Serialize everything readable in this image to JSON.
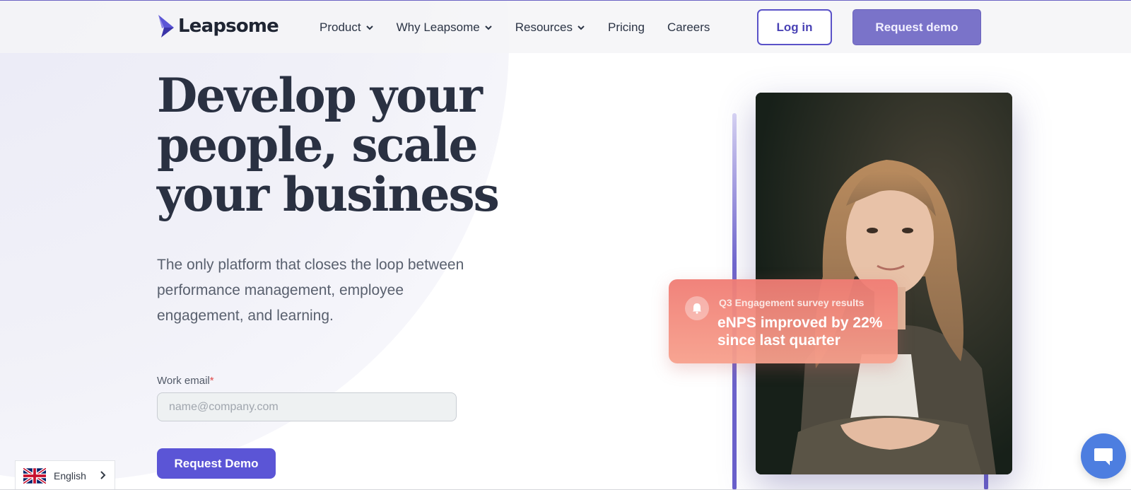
{
  "brand": {
    "name": "Leapsome"
  },
  "nav": {
    "items": [
      {
        "label": "Product",
        "has_dropdown": true
      },
      {
        "label": "Why Leapsome",
        "has_dropdown": true
      },
      {
        "label": "Resources",
        "has_dropdown": true
      },
      {
        "label": "Pricing",
        "has_dropdown": false
      },
      {
        "label": "Careers",
        "has_dropdown": false
      }
    ],
    "login_label": "Log in",
    "request_demo_label": "Request demo"
  },
  "hero": {
    "headline_lines": [
      "Develop your",
      "people, scale",
      "your business"
    ],
    "subtext": "The only platform that closes the loop between performance management, employee engagement, and learning.",
    "email_label": "Work email",
    "email_required_mark": "*",
    "email_placeholder": "name@company.com",
    "email_value": "",
    "cta_label": "Request Demo"
  },
  "notification": {
    "icon": "bell-icon",
    "title": "Q3 Engagement survey results",
    "body": "eNPS improved by 22% since last quarter"
  },
  "language": {
    "label": "English",
    "flag": "uk-flag-icon"
  },
  "chat": {
    "icon": "chat-icon"
  },
  "colors": {
    "accent": "#5b55d6",
    "accent_muted": "#7a73c9",
    "notification": "#f07c74",
    "chat": "#4d7ee0"
  }
}
